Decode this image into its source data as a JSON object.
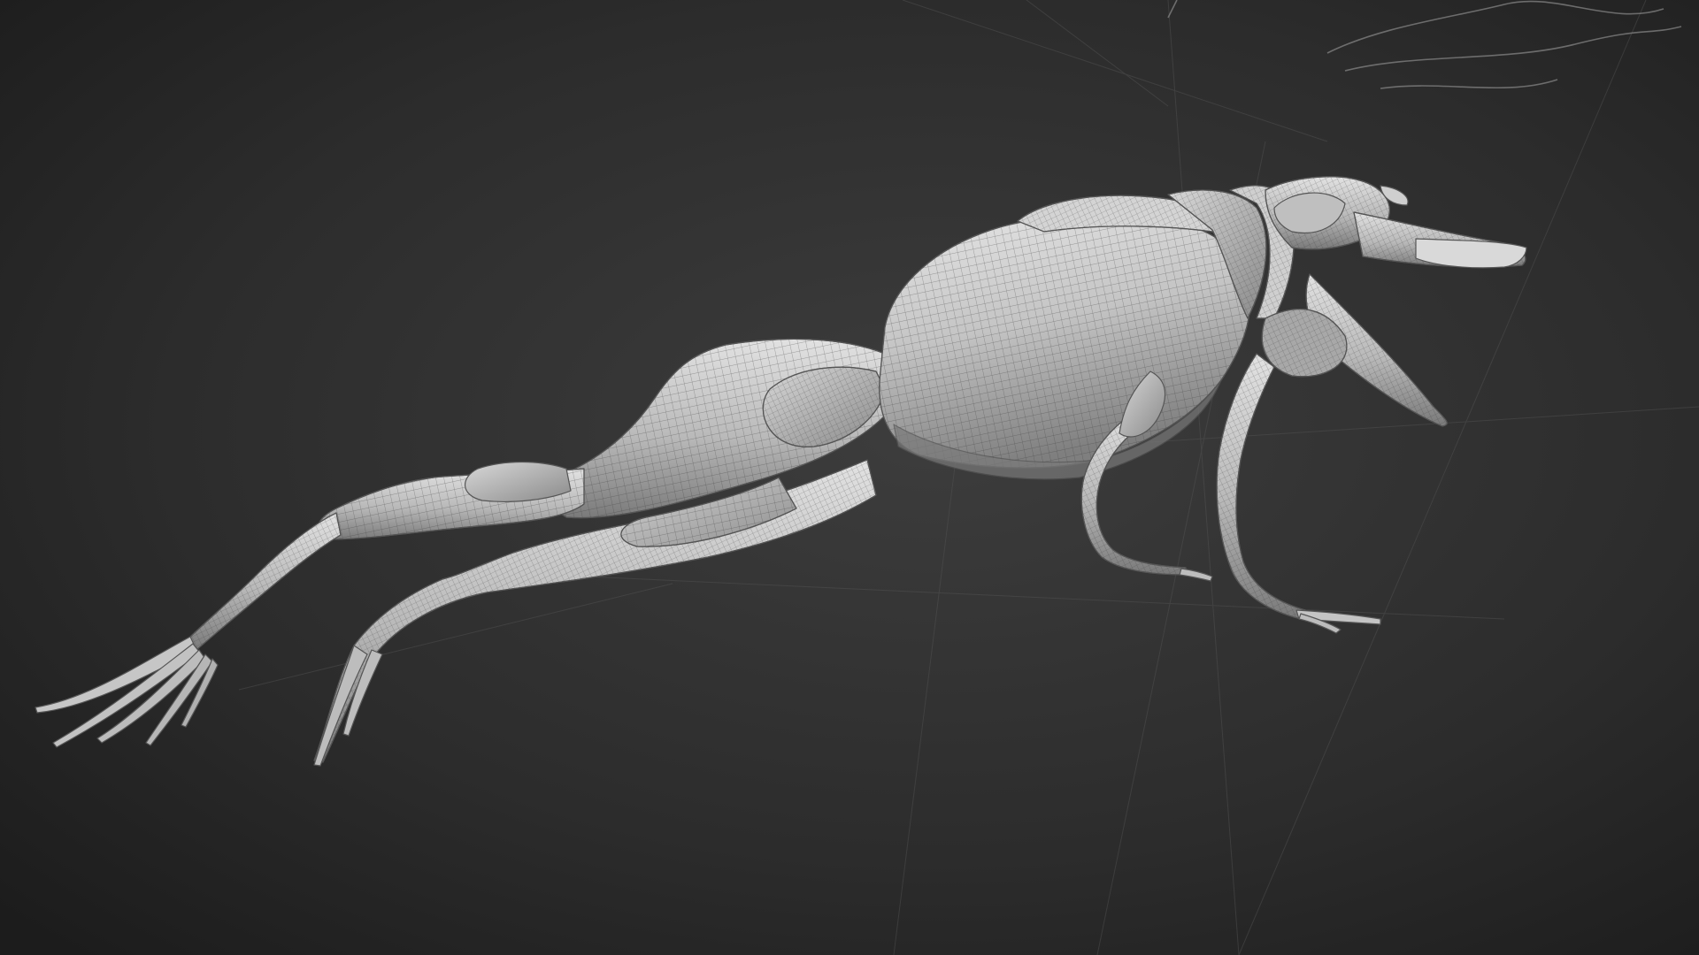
{
  "scene": {
    "subject": "frog-muscle-wireframe-model",
    "colors": {
      "background_center": "#3a3a3a",
      "background_edge": "#1e1e1e",
      "mesh_fill_light": "#d9d9d9",
      "mesh_fill_mid": "#a9a9a9",
      "mesh_fill_dark": "#6f6f6f",
      "wire": "#3c3c3c",
      "guide_lines": "#5a5a5a"
    }
  }
}
